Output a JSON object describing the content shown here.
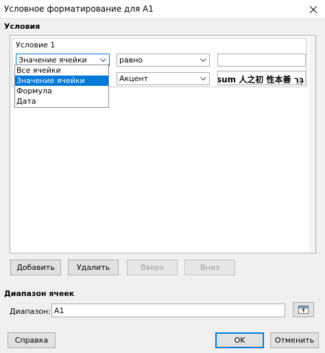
{
  "window": {
    "title": "Условное форматирование для A1"
  },
  "conditions_section": {
    "title": "Условия",
    "condition": {
      "label": "Условие 1",
      "type_value": "Значение ячейки",
      "operator_value": "равно",
      "value_field": "",
      "style_value": "Акцент",
      "preview_text": "sum   人之初 性本善   בְּרֵ"
    },
    "type_options": [
      "Все ячейки",
      "Значение ячейки",
      "Формула",
      "Дата"
    ],
    "selected_option_index": 1
  },
  "buttons": {
    "add": "Добавить",
    "delete": "Удалить",
    "up": "Вверх",
    "down": "Вниз"
  },
  "range_section": {
    "title": "Диапазон ячеек",
    "label": "Диапазон:",
    "value": "A1"
  },
  "footer": {
    "help": "Справка",
    "ok": "OK",
    "cancel": "Отменить"
  }
}
